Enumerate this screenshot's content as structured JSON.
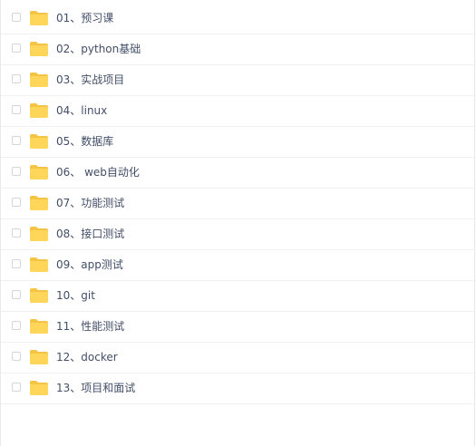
{
  "icons": {
    "checkbox": "checkbox-icon",
    "folder": "folder-icon",
    "folder_color": "#ffd55a",
    "folder_tab_color": "#f5c445"
  },
  "files": [
    {
      "name": "01、预习课"
    },
    {
      "name": "02、python基础"
    },
    {
      "name": "03、实战项目"
    },
    {
      "name": "04、linux"
    },
    {
      "name": "05、数据库"
    },
    {
      "name": "06、 web自动化"
    },
    {
      "name": "07、功能测试"
    },
    {
      "name": "08、接口测试"
    },
    {
      "name": "09、app测试"
    },
    {
      "name": "10、git"
    },
    {
      "name": "11、性能测试"
    },
    {
      "name": "12、docker"
    },
    {
      "name": "13、项目和面试"
    }
  ]
}
